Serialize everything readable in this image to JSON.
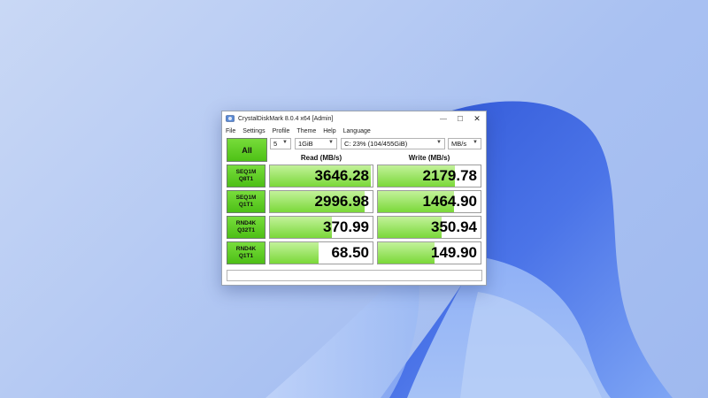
{
  "window": {
    "title": "CrystalDiskMark 8.0.4 x64 [Admin]",
    "controls": {
      "minimize": "—",
      "maximize": "☐",
      "close": "✕"
    }
  },
  "menu": [
    "File",
    "Settings",
    "Profile",
    "Theme",
    "Help",
    "Language"
  ],
  "toolbar": {
    "all_label": "All",
    "count": "5",
    "size": "1GiB",
    "drive": "C: 23% (104/455GiB)",
    "unit": "MB/s"
  },
  "headers": {
    "read": "Read (MB/s)",
    "write": "Write (MB/s)"
  },
  "rows": [
    {
      "line1": "SEQ1M",
      "line2": "Q8T1",
      "read": "3646.28",
      "write": "2179.78",
      "read_fill": 0.98,
      "write_fill": 0.75
    },
    {
      "line1": "SEQ1M",
      "line2": "Q1T1",
      "read": "2996.98",
      "write": "1464.90",
      "read_fill": 0.92,
      "write_fill": 0.74
    },
    {
      "line1": "RND4K",
      "line2": "Q32T1",
      "read": "370.99",
      "write": "350.94",
      "read_fill": 0.6,
      "write_fill": 0.62
    },
    {
      "line1": "RND4K",
      "line2": "Q1T1",
      "read": "68.50",
      "write": "149.90",
      "read_fill": 0.47,
      "write_fill": 0.55
    }
  ],
  "status": ""
}
